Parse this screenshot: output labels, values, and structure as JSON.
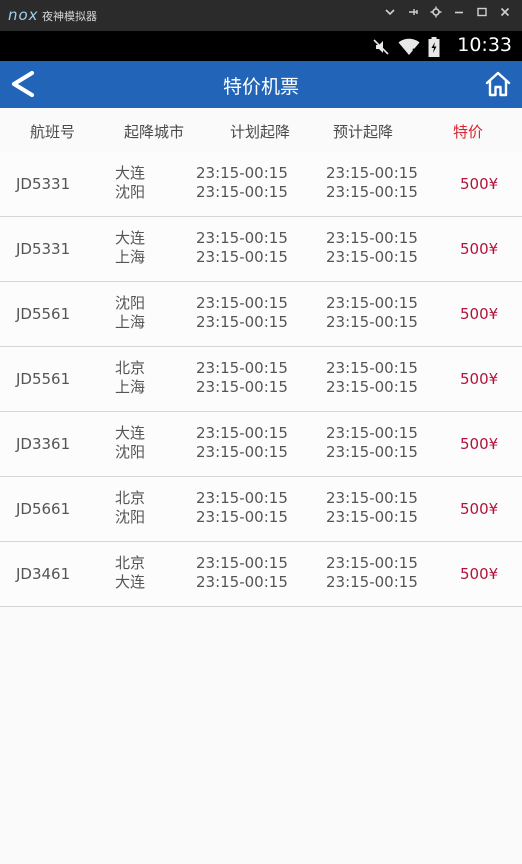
{
  "emulator": {
    "logo": "nox",
    "title": "夜神模拟器",
    "controls": [
      "chevron-down-icon",
      "pin-icon",
      "gear-icon",
      "minimize-icon",
      "maximize-icon",
      "close-icon"
    ]
  },
  "status_bar": {
    "time": "10:33",
    "icons": [
      "mute-icon",
      "wifi-icon",
      "battery-charging-icon"
    ]
  },
  "header": {
    "title": "特价机票",
    "back_icon": "back-arrow-icon",
    "home_icon": "home-icon",
    "color": "#2265b8"
  },
  "columns": {
    "flight": "航班号",
    "city": "起降城市",
    "plan": "计划起降",
    "estimate": "预计起降",
    "price": "特价"
  },
  "flights": [
    {
      "flight": "JD5331",
      "from": "大连",
      "to": "沈阳",
      "plan_1": "23:15-00:15",
      "plan_2": "23:15-00:15",
      "est_1": "23:15-00:15",
      "est_2": "23:15-00:15",
      "price": "500¥"
    },
    {
      "flight": "JD5331",
      "from": "大连",
      "to": "上海",
      "plan_1": "23:15-00:15",
      "plan_2": "23:15-00:15",
      "est_1": "23:15-00:15",
      "est_2": "23:15-00:15",
      "price": "500¥"
    },
    {
      "flight": "JD5561",
      "from": "沈阳",
      "to": "上海",
      "plan_1": "23:15-00:15",
      "plan_2": "23:15-00:15",
      "est_1": "23:15-00:15",
      "est_2": "23:15-00:15",
      "price": "500¥"
    },
    {
      "flight": "JD5561",
      "from": "北京",
      "to": "上海",
      "plan_1": "23:15-00:15",
      "plan_2": "23:15-00:15",
      "est_1": "23:15-00:15",
      "est_2": "23:15-00:15",
      "price": "500¥"
    },
    {
      "flight": "JD3361",
      "from": "大连",
      "to": "沈阳",
      "plan_1": "23:15-00:15",
      "plan_2": "23:15-00:15",
      "est_1": "23:15-00:15",
      "est_2": "23:15-00:15",
      "price": "500¥"
    },
    {
      "flight": "JD5661",
      "from": "北京",
      "to": "沈阳",
      "plan_1": "23:15-00:15",
      "plan_2": "23:15-00:15",
      "est_1": "23:15-00:15",
      "est_2": "23:15-00:15",
      "price": "500¥"
    },
    {
      "flight": "JD3461",
      "from": "北京",
      "to": "大连",
      "plan_1": "23:15-00:15",
      "plan_2": "23:15-00:15",
      "est_1": "23:15-00:15",
      "est_2": "23:15-00:15",
      "price": "500¥"
    }
  ],
  "colors": {
    "price_header": "#d8262f",
    "price_value": "#b3123a"
  }
}
